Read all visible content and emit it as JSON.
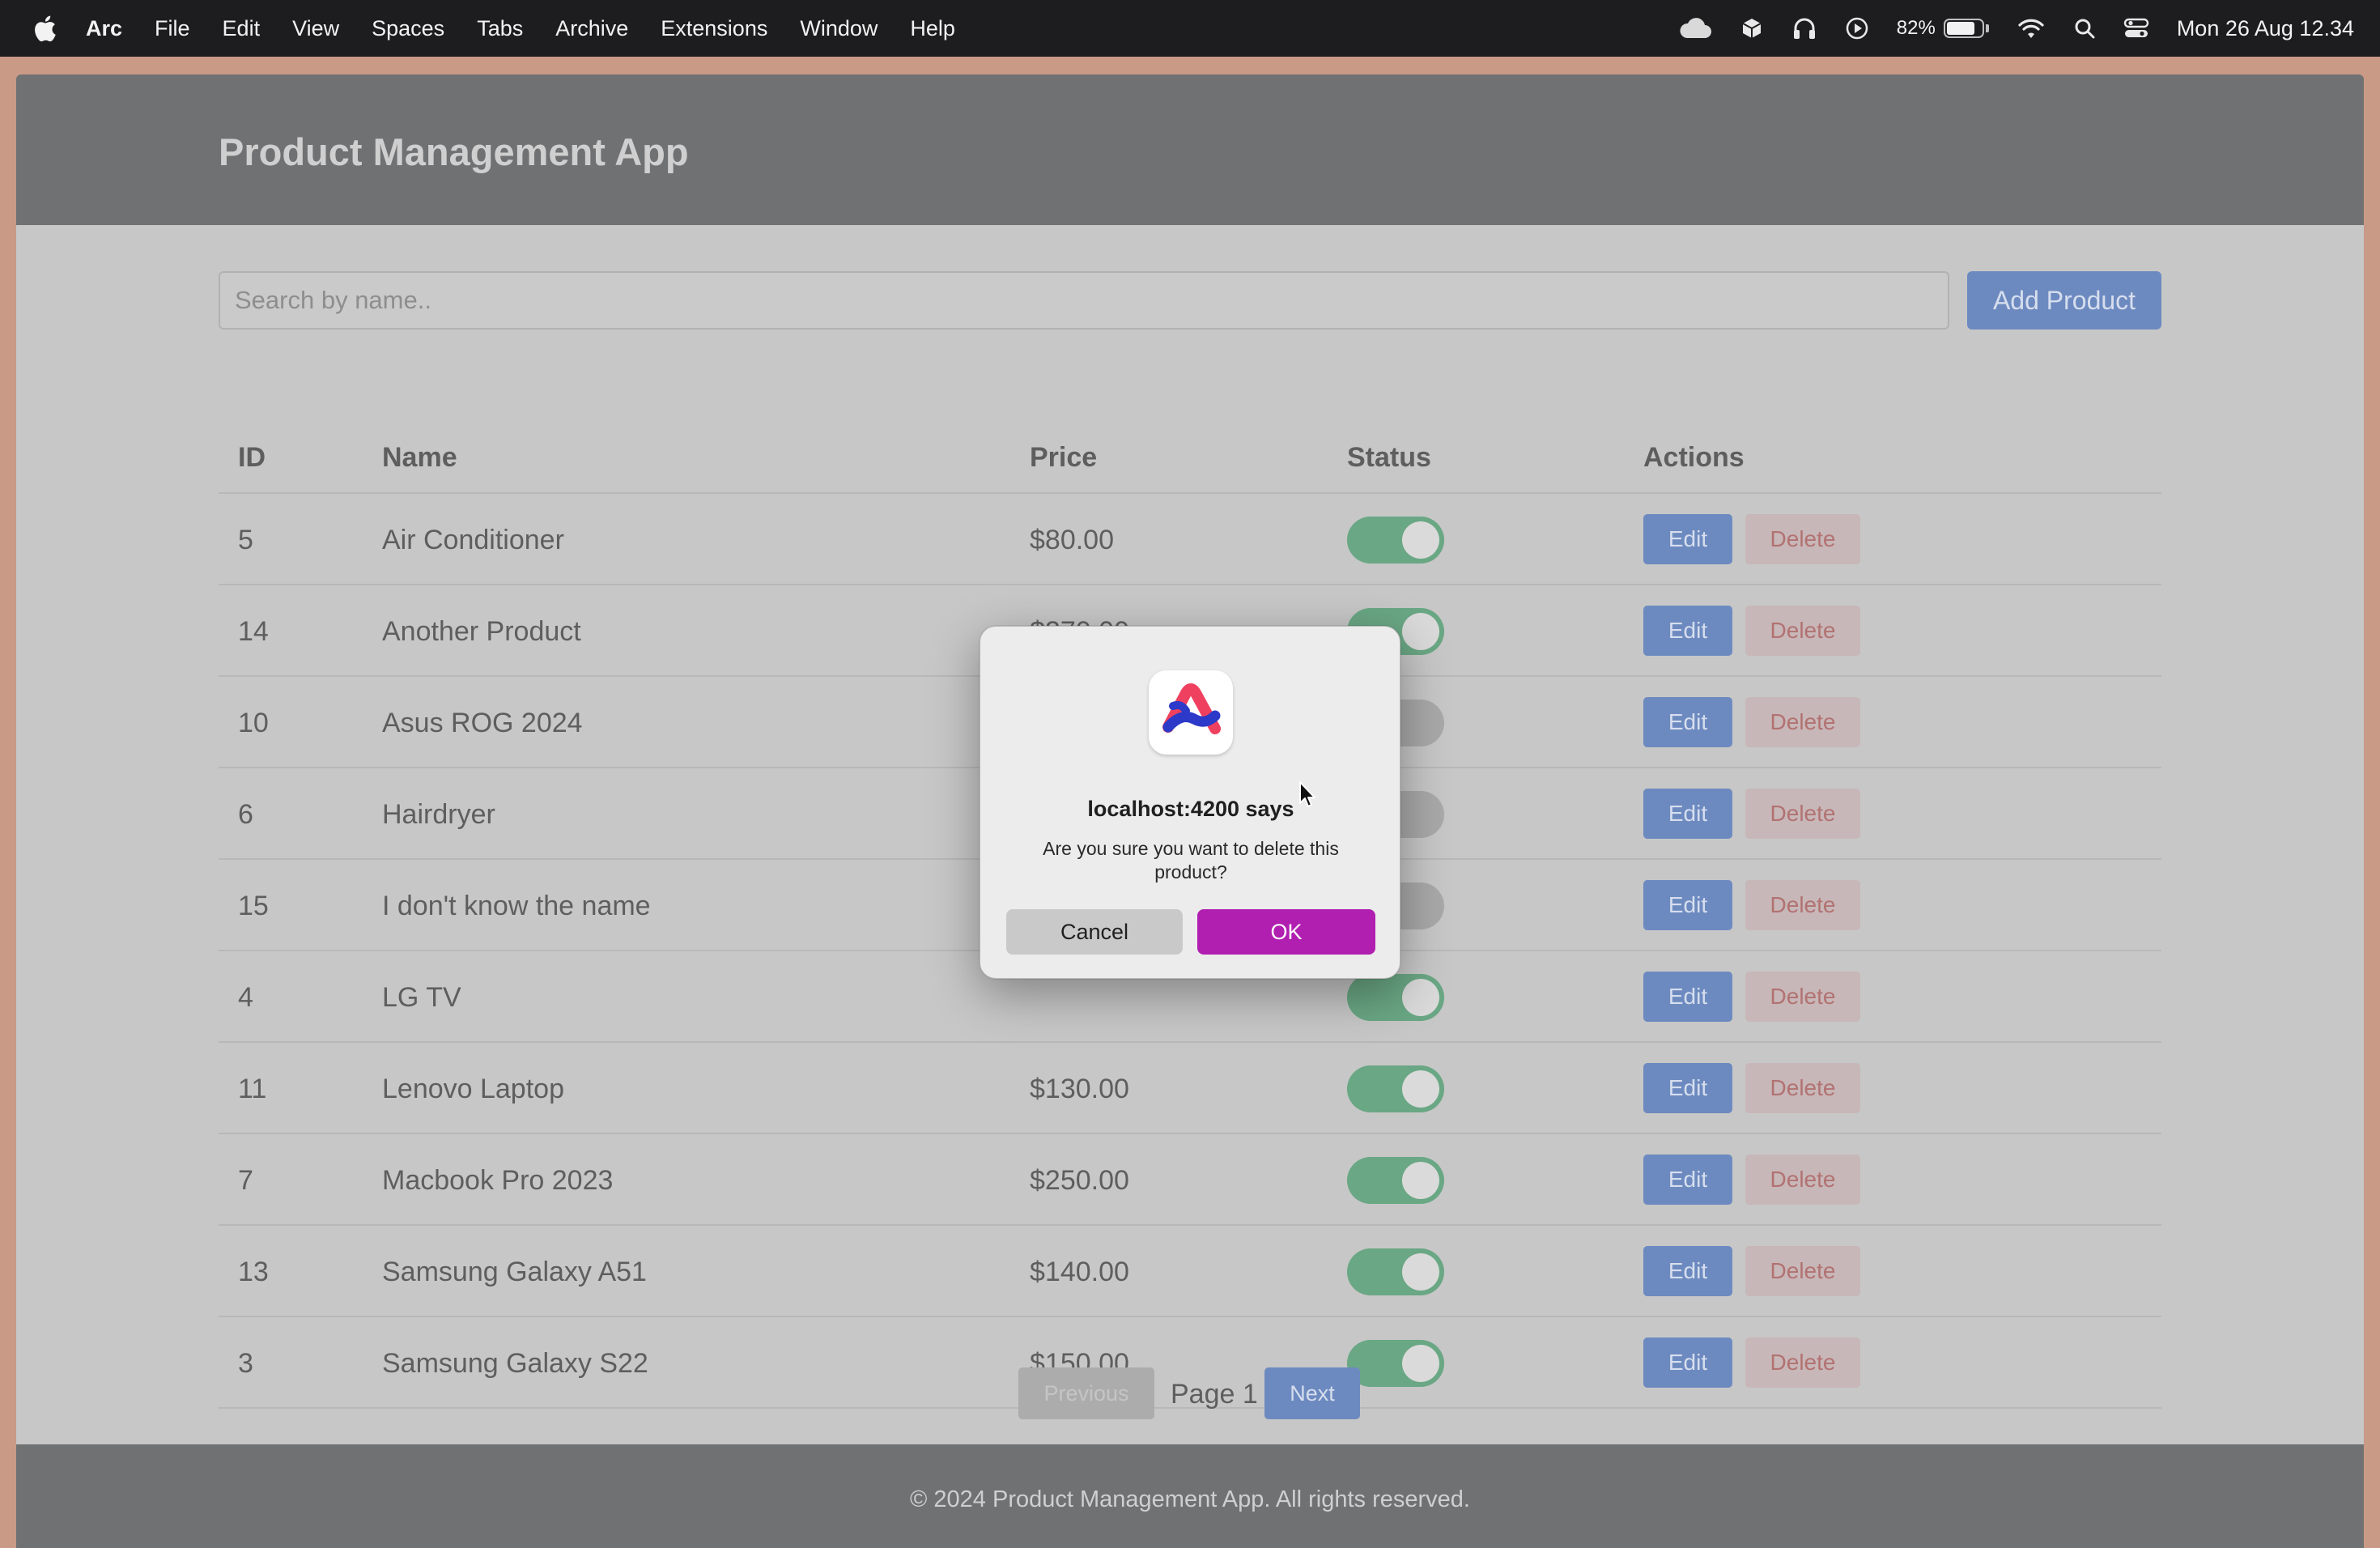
{
  "menubar": {
    "app_name": "Arc",
    "items": [
      "File",
      "Edit",
      "View",
      "Spaces",
      "Tabs",
      "Archive",
      "Extensions",
      "Window",
      "Help"
    ],
    "battery_percent": "82%",
    "battery_level": 0.82,
    "clock": "Mon 26 Aug  12.34",
    "status_icons": [
      "cloud-icon",
      "ext-icon",
      "headphones-icon",
      "play-icon",
      "battery-icon",
      "wifi-icon",
      "search-icon",
      "control-center-icon"
    ]
  },
  "app": {
    "title": "Product Management App",
    "search_placeholder": "Search by name..",
    "add_button": "Add Product"
  },
  "table": {
    "headers": {
      "id": "ID",
      "name": "Name",
      "price": "Price",
      "status": "Status",
      "actions": "Actions"
    },
    "rows": [
      {
        "id": "5",
        "name": "Air Conditioner",
        "price": "$80.00",
        "active": true
      },
      {
        "id": "14",
        "name": "Another Product",
        "price": "$270.00",
        "active": true
      },
      {
        "id": "10",
        "name": "Asus ROG 2024",
        "price": "",
        "active": false
      },
      {
        "id": "6",
        "name": "Hairdryer",
        "price": "",
        "active": false
      },
      {
        "id": "15",
        "name": "I don't know the name",
        "price": "",
        "active": false
      },
      {
        "id": "4",
        "name": "LG TV",
        "price": "",
        "active": true
      },
      {
        "id": "11",
        "name": "Lenovo Laptop",
        "price": "$130.00",
        "active": true
      },
      {
        "id": "7",
        "name": "Macbook Pro 2023",
        "price": "$250.00",
        "active": true
      },
      {
        "id": "13",
        "name": "Samsung Galaxy A51",
        "price": "$140.00",
        "active": true
      },
      {
        "id": "3",
        "name": "Samsung Galaxy S22",
        "price": "$150.00",
        "active": true
      }
    ],
    "edit_label": "Edit",
    "delete_label": "Delete"
  },
  "pagination": {
    "previous": "Previous",
    "page_label": "Page 1",
    "next": "Next"
  },
  "footer": {
    "text": "© 2024 Product Management App. All rights reserved."
  },
  "dialog": {
    "title": "localhost:4200 says",
    "message": "Are you sure you want to delete this product?",
    "cancel": "Cancel",
    "ok": "OK",
    "icon": "arc-browser-icon"
  },
  "colors": {
    "ok_button": "#b01fb0",
    "edit_button": "#6d8ac0",
    "toggle_on": "#6aa784",
    "header_bg": "#707173"
  }
}
